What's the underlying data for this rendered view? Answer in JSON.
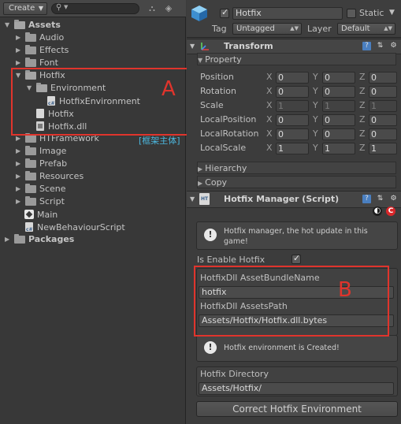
{
  "project": {
    "create_label": "Create",
    "tree": [
      {
        "label": "Assets",
        "bold": true,
        "expanded": true,
        "icon": "folder-open-icon"
      },
      {
        "label": "Audio",
        "icon": "folder-icon"
      },
      {
        "label": "Effects",
        "icon": "folder-icon"
      },
      {
        "label": "Font",
        "icon": "folder-icon"
      },
      {
        "label": "Hotfix",
        "expanded": true,
        "icon": "folder-open-icon"
      },
      {
        "label": "Environment",
        "expanded": true,
        "icon": "folder-open-icon"
      },
      {
        "label": "HotfixEnvironment",
        "icon": "csharp-file-icon"
      },
      {
        "label": "Hotfix",
        "icon": "asmdef-file-icon"
      },
      {
        "label": "Hotfix.dll",
        "icon": "dll-file-icon"
      },
      {
        "label": "HTFramework",
        "icon": "folder-icon"
      },
      {
        "label": "Image",
        "icon": "folder-icon"
      },
      {
        "label": "Prefab",
        "icon": "folder-icon"
      },
      {
        "label": "Resources",
        "icon": "folder-icon"
      },
      {
        "label": "Scene",
        "icon": "folder-icon"
      },
      {
        "label": "Script",
        "icon": "folder-icon"
      },
      {
        "label": "Main",
        "icon": "unity-scene-icon"
      },
      {
        "label": "NewBehaviourScript",
        "icon": "csharp-file-icon"
      },
      {
        "label": "Packages",
        "bold": true,
        "icon": "folder-icon"
      }
    ],
    "htframework_tag": "[框架主体]"
  },
  "gameobject": {
    "name": "Hotfix",
    "static_label": "Static",
    "tag_label": "Tag",
    "tag_value": "Untagged",
    "layer_label": "Layer",
    "layer_value": "Default"
  },
  "transform": {
    "title": "Transform",
    "property_label": "Property",
    "rows": [
      {
        "label": "Position",
        "x": "0",
        "y": "0",
        "z": "0",
        "disabled": false
      },
      {
        "label": "Rotation",
        "x": "0",
        "y": "0",
        "z": "0",
        "disabled": false
      },
      {
        "label": "Scale",
        "x": "1",
        "y": "1",
        "z": "1",
        "disabled": true
      },
      {
        "label": "LocalPosition",
        "x": "0",
        "y": "0",
        "z": "0",
        "disabled": false
      },
      {
        "label": "LocalRotation",
        "x": "0",
        "y": "0",
        "z": "0",
        "disabled": false
      },
      {
        "label": "LocalScale",
        "x": "1",
        "y": "1",
        "z": "1",
        "disabled": false
      }
    ],
    "axis_x": "X",
    "axis_y": "Y",
    "axis_z": "Z",
    "hierarchy_label": "Hierarchy",
    "copy_label": "Copy"
  },
  "hotfix_manager": {
    "title": "Hotfix Manager (Script)",
    "info_text": "Hotfix manager, the hot update in this game!",
    "enable_label": "Is Enable Hotfix",
    "bundle_name_label": "HotfixDll AssetBundleName",
    "bundle_name_value": "hotfix",
    "assets_path_label": "HotfixDll AssetsPath",
    "assets_path_value": "Assets/Hotfix/Hotfix.dll.bytes",
    "env_created_text": "Hotfix environment is Created!",
    "directory_label": "Hotfix Directory",
    "directory_value": "Assets/Hotfix/",
    "correct_button": "Correct Hotfix Environment"
  },
  "annotations": {
    "label_a": "A",
    "label_b": "B"
  },
  "colors": {
    "annotation_red": "#e0342c",
    "htframework_blue": "#4cb8e0"
  }
}
